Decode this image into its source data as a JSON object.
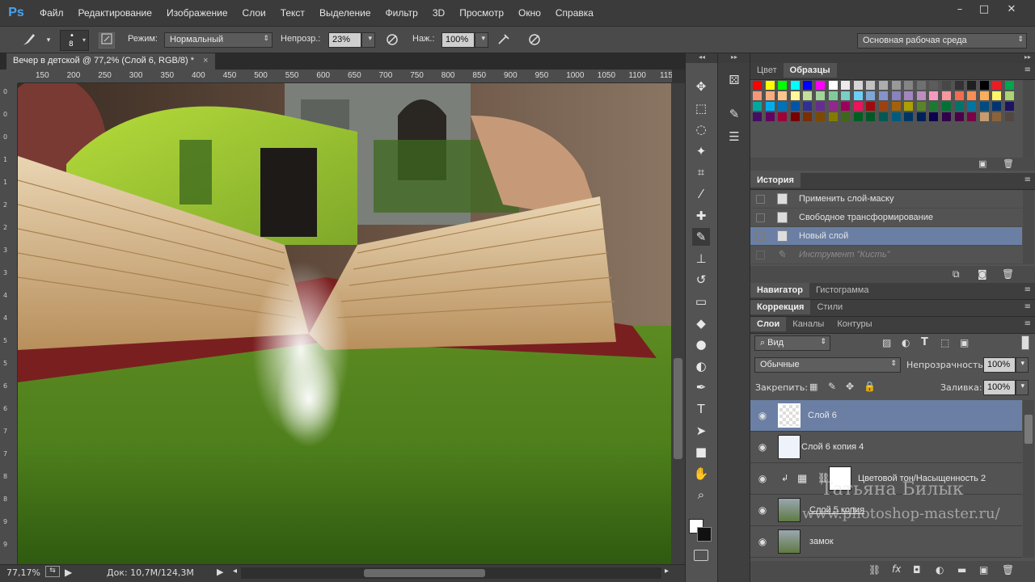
{
  "app": {
    "logo": "Ps"
  },
  "menu": [
    "Файл",
    "Редактирование",
    "Изображение",
    "Слои",
    "Текст",
    "Выделение",
    "Фильтр",
    "3D",
    "Просмотр",
    "Окно",
    "Справка"
  ],
  "window_controls": [
    "–",
    "□",
    "✕"
  ],
  "options": {
    "brush_size": "8",
    "mode_label": "Режим:",
    "mode_value": "Нормальный",
    "opacity_label": "Непрозр.:",
    "opacity_value": "23%",
    "flow_label": "Наж.:",
    "flow_value": "100%",
    "workspace": "Основная рабочая среда"
  },
  "document": {
    "tab_title": "Вечер в детской @ 77,2% (Слой 6, RGB/8) *",
    "close": "×"
  },
  "ruler": {
    "top": [
      "150",
      "200",
      "250",
      "300",
      "350",
      "400",
      "450",
      "500",
      "550",
      "600",
      "650",
      "700",
      "750",
      "800",
      "850",
      "900",
      "950",
      "1000",
      "1050",
      "1100",
      "115"
    ],
    "left": [
      "0",
      "0",
      "0",
      "1",
      "1",
      "2",
      "2",
      "3",
      "3",
      "4",
      "4",
      "5",
      "5",
      "6",
      "6",
      "7",
      "7",
      "8",
      "8",
      "9",
      "9"
    ]
  },
  "tools": [
    "move-icon",
    "marquee-icon",
    "lasso-icon",
    "magic-wand-icon",
    "crop-icon",
    "eyedropper-icon",
    "healing-icon",
    "brush-icon",
    "stamp-icon",
    "history-brush-icon",
    "eraser-icon",
    "bucket-icon",
    "blur-icon",
    "dodge-icon",
    "pen-icon",
    "type-icon",
    "path-select-icon",
    "shape-icon",
    "hand-icon",
    "zoom-icon"
  ],
  "panels": {
    "color_tabs": [
      "Цвет",
      "Образцы"
    ],
    "history_title": "История",
    "history": [
      {
        "label": "Применить слой-маску",
        "active": false
      },
      {
        "label": "Свободное трансформирование",
        "active": false
      },
      {
        "label": "Новый слой",
        "active": true
      },
      {
        "label": "Инструмент \"Кисть\"",
        "active": false
      }
    ],
    "nav_tabs": [
      "Навигатор",
      "Гистограмма"
    ],
    "adj_tabs": [
      "Коррекция",
      "Стили"
    ],
    "layers_tabs": [
      "Слои",
      "Каналы",
      "Контуры"
    ],
    "filter_kind": "Вид",
    "blend_mode": "Обычные",
    "opacity_label": "Непрозрачность:",
    "opacity_value": "100%",
    "lock_label": "Закрепить:",
    "fill_label": "Заливка:",
    "fill_value": "100%",
    "layers": [
      {
        "name": "Слой 6",
        "selected": true
      },
      {
        "name": "Слой 6 копия 4",
        "selected": false
      },
      {
        "name": "Цветовой тон/Насыщенность 2",
        "selected": false
      },
      {
        "name": "Слой 5 копия",
        "selected": false
      },
      {
        "name": "замок",
        "selected": false
      }
    ]
  },
  "status": {
    "zoom": "77,17%",
    "doc": "Док: 10,7M/124,3M"
  },
  "watermark": {
    "name": "Татьяна Билык",
    "url": "www.photoshop-master.ru/"
  },
  "colors": {
    "accent_selection": "#6a7fa3",
    "panel_bg": "#535353"
  }
}
